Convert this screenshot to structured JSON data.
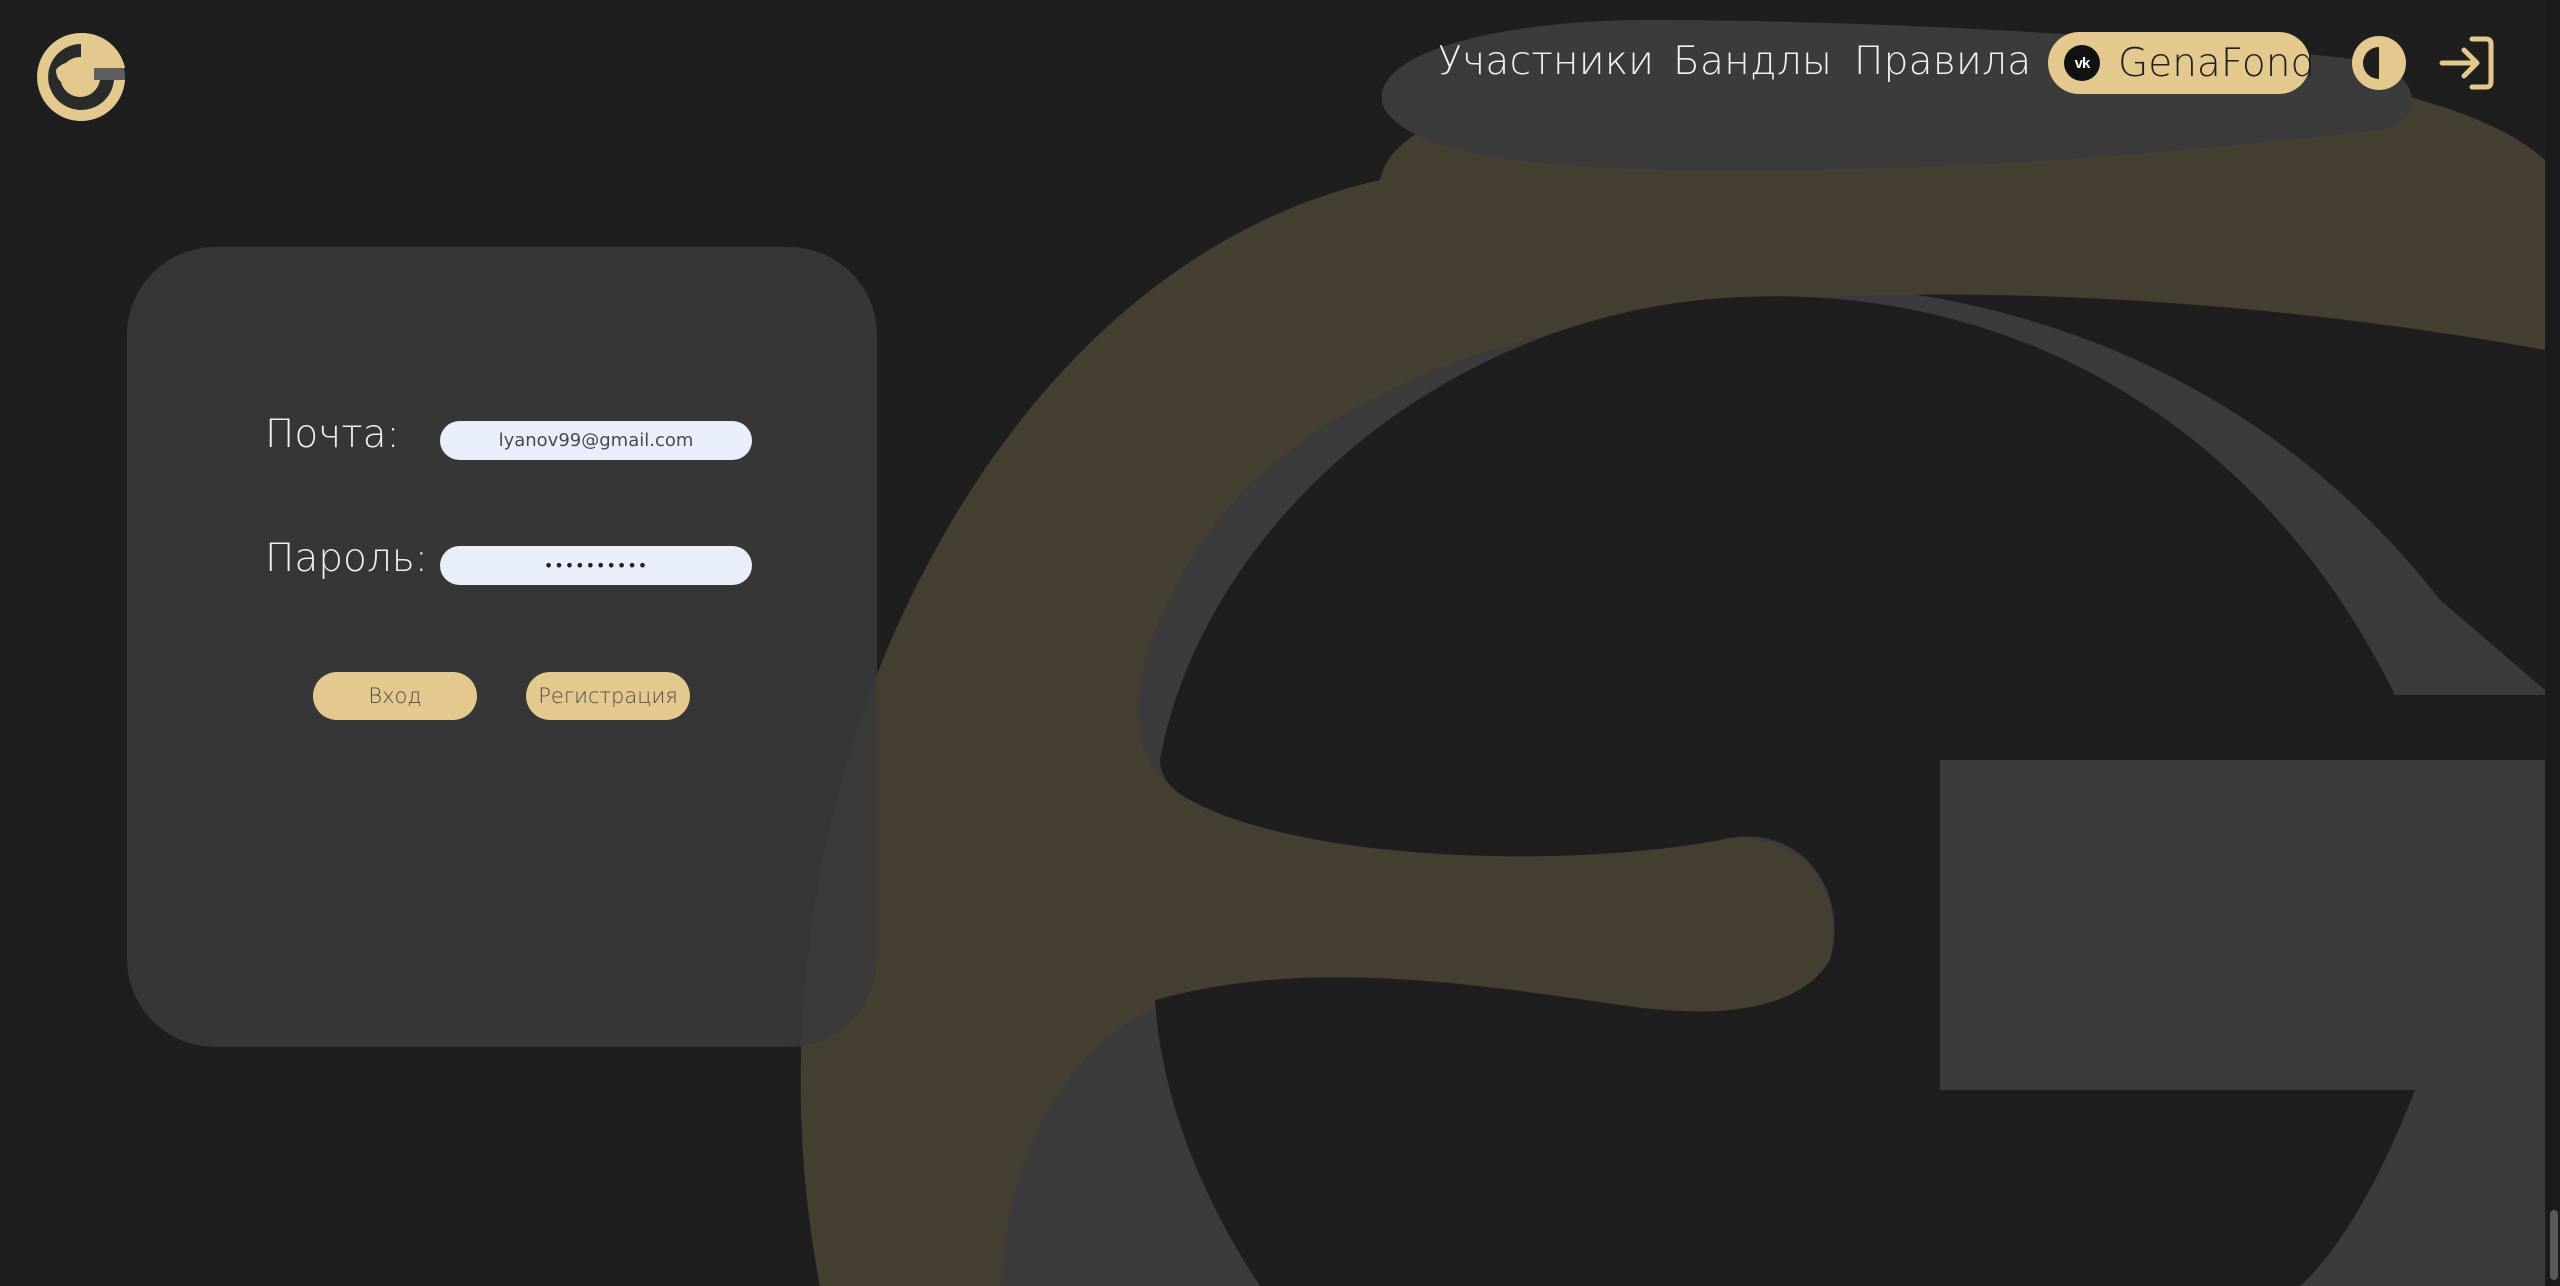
{
  "header": {
    "logo_icon": "genafond-g-logo",
    "nav": [
      {
        "label": "Участники"
      },
      {
        "label": "Бандлы"
      },
      {
        "label": "Правила"
      }
    ],
    "vk_button": {
      "icon": "vk-icon",
      "icon_text": "vk",
      "label": "GenaFond"
    },
    "theme_toggle_icon": "half-circle-contrast-icon",
    "login_icon": "sign-in-arrow-icon"
  },
  "login_form": {
    "email_label": "Почта:",
    "email_value": "lyanov99@gmail.com",
    "password_label": "Пароль:",
    "password_value": "••••••••••",
    "login_button": "Вход",
    "register_button": "Регистрация"
  },
  "colors": {
    "background": "#1e1e1e",
    "accent": "#e3c98d",
    "card": "#3a3a3a",
    "input_bg": "#e9effa",
    "bg_gray": "#3b3b3b",
    "bg_olive": "#453f31"
  }
}
